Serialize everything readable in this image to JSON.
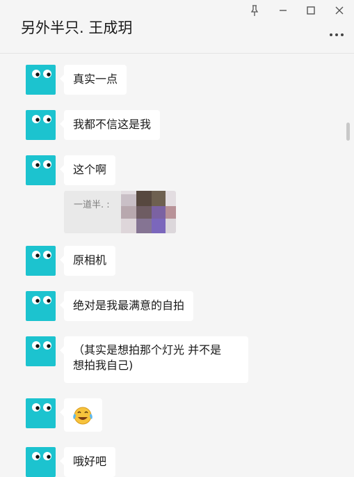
{
  "window": {
    "title": "另外半只. 王成玥",
    "controls": [
      "pin-icon",
      "minimize-icon",
      "maximize-icon",
      "close-icon",
      "more-icon"
    ]
  },
  "colors": {
    "background": "#f5f5f5",
    "bubble": "#ffffff",
    "avatar": "#1cc3cf",
    "quote_background": "#e9e9e9"
  },
  "messages": [
    {
      "text": "真实一点"
    },
    {
      "text": "我都不信这是我"
    },
    {
      "text": "这个啊",
      "quote": {
        "text": "一道半. :",
        "image": "pixelated-thumbnail"
      }
    },
    {
      "text": "原相机"
    },
    {
      "text": "绝对是我最满意的自拍"
    },
    {
      "line1": "（其实是想拍那个灯光 并不是",
      "line2": "想拍我自己)"
    },
    {
      "emoji": "laughing-crying-emoji"
    },
    {
      "text": "哦好吧"
    }
  ]
}
